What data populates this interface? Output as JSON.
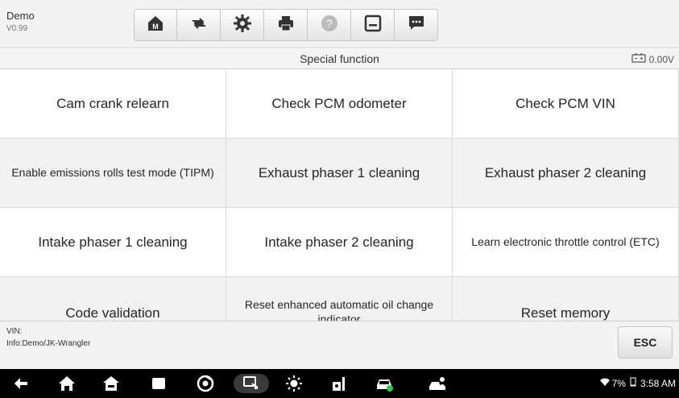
{
  "app": {
    "name": "Demo",
    "version": "V0.99"
  },
  "toolbar": {
    "items": [
      "home-icon",
      "vehicle-swap-icon",
      "settings-icon",
      "print-icon",
      "help-icon",
      "save-icon",
      "message-icon"
    ]
  },
  "header": {
    "title": "Special function",
    "battery_voltage": "0.00V"
  },
  "functions": [
    "Cam crank relearn",
    "Check PCM odometer",
    "Check PCM VIN",
    "Enable emissions rolls test mode (TIPM)",
    "Exhaust phaser 1 cleaning",
    "Exhaust phaser 2 cleaning",
    "Intake phaser 1 cleaning",
    "Intake phaser 2 cleaning",
    "Learn electronic throttle control (ETC)",
    "Code validation",
    "Reset enhanced automatic oil change indicator",
    "Reset memory"
  ],
  "footer": {
    "vin_label": "VIN:",
    "info": "Info:Demo/JK-Wrangler",
    "esc_label": "ESC"
  },
  "status_bar": {
    "battery": "7%",
    "time": "3:58 AM"
  },
  "colors": {
    "accent_green": "#2ecc40",
    "toolbar_bg": "#f2f2f2",
    "nav_bg": "#000000"
  }
}
